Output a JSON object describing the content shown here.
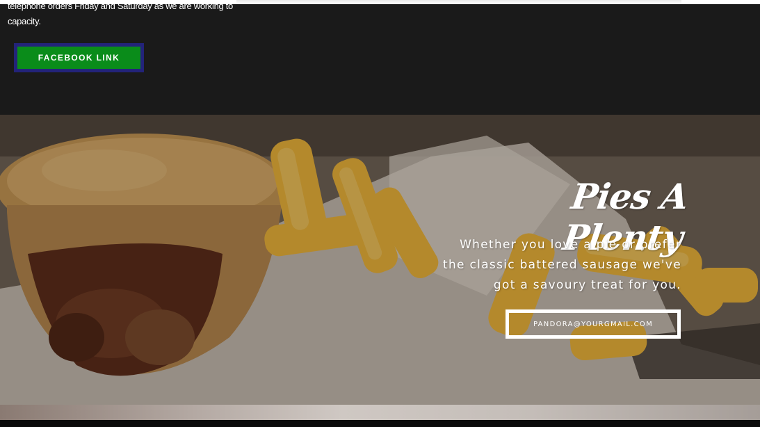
{
  "info": {
    "text_line1": "telephone orders Friday and Saturday as we are working to",
    "text_line2": "capacity.",
    "facebook_button_label": "FACEBOOK LINK"
  },
  "hero": {
    "title": "Pies A Plenty",
    "description_line1": "Whether you love a pie or prefer",
    "description_line2": "the classic battered sausage we've",
    "description_line3": "got a savoury treat for you.",
    "email_button_label": "PANDORA@YOURGMAIL.COM",
    "background_image": "meat-pie-and-chips-photo"
  },
  "colors": {
    "facebook_button_bg": "#0a8c1a",
    "facebook_button_border": "#23237a",
    "section_dark_bg": "#1a1a1a"
  }
}
